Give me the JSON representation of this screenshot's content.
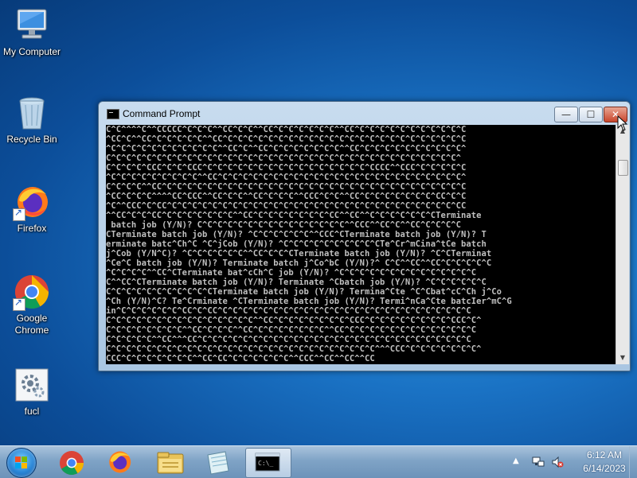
{
  "desktop": {
    "icons": [
      {
        "label": "My Computer"
      },
      {
        "label": "Recycle Bin"
      },
      {
        "label": "Firefox"
      },
      {
        "label": "Google Chrome"
      },
      {
        "label": "fucl"
      }
    ]
  },
  "window": {
    "title": "Command Prompt",
    "buttons": {
      "minimize": "—",
      "maximize": "☐",
      "close": "✕"
    },
    "console_lines": [
      "C^C^^^^C^^CCCCC^C^C^C^^CC^C^C^^CC^C^C^C^C^C^C^^CC^C^C^C^C^C^C^C^C^C^C^C",
      "^CC^C^^CC^C^C^C^C^C^^CC^C^C^C^C^C^C^C^C^C^C^C^C^C^C^C^C^C^C^C^C^C^C^C^C",
      "^C^C^C^C^C^C^C^C^C^C^C^^CC^C^^CC^C^C^C^C^C^C^C^^CC^C^C^C^C^C^C^C^C^C^C^",
      "C^C^C^C^C^C^C^C^C^C^C^C^C^C^C^C^C^C^C^C^C^C^C^C^C^C^C^C^C^C^C^C^C^C^C^",
      "C^C^C^C^CCC^C^C^CCC^C^C^C^C^C^C^C^C^C^C^C^C^C^C^C^C^CCCC^^CCC^C^C^C^C^C",
      "^C^C^C^C^C^C^C^C^C^^CC^C^C^C^C^C^C^C^C^C^C^C^C^C^C^C^C^C^C^C^C^C^C^C^C^",
      "C^C^C^C^^CC^C^C^C^C^C^C^C^C^C^C^C^C^C^C^C^C^C^C^C^C^C^C^C^C^C^C^C^C^C^C",
      "^CC^C^C^C^^^^CC^CCC^^CC^C^C^^CC^C^C^C^^CCC^C^C^^CC^C^C^C^C^C^C^C^CC^C^C",
      "^C^^CCC^C^CC^C^C^C^C^C^C^C^C^C^C^C^C^C^C^C^C^C^C^C^C^C^C^C^C^C^C^C^C^CC",
      "^^CC^C^C^CC^C^C^C^C^C^C^C^^CC^C^C^C^C^C^C^C^CC^^CC^^C^C^C^C^C^C^CTerminate",
      " batch job (Y/N)? C^C^C^C^C^C^C^C^C^C^C^C^C^C^C^^CCC^^CC^C^^CC^C^C^C^C",
      "CTerminate batch job (Y/N)? ^C^C^C^C^C^C^^CCC^CTerminate batch job (Y/N)? T",
      "erminate batc^Ch^C ^C^jCob (Y/N)? ^C^C^C^C^C^C^C^C^C^CTe^Cr^mCina^tCe batch",
      "j^Cob (Y/N^C)? ^C^C^C^C^C^C^^CC^C^C^CTerminate batch job (Y/N)? ^C^CTerminat",
      "^Ce^C batch job (Y/N)? Terminate batch j^Co^bC (Y/N)?^ C^C^^CC^^CC^C^C^C^C^C",
      "^C^C^C^C^^CC^CTerminate bat^cCh^C job (Y/N)? ^C^C^C^C^C^C^C^C^C^C^C^C^C^C",
      "C^^CC^CTerminate batch job (Y/N)? Terminate ^Cbatch job (Y/N)? ^C^C^C^C^C^C",
      "C^C^C^C^C^C^C^C^C^C^CTerminate batch job (Y/N)? Termina^Cte ^C^Cbat^cC^Ch j^Co",
      "^Ch (Y/N)^C? Te^Crminate ^CTerminate batch job (Y/N)? Termi^nCa^Cte batcIer^mC^G",
      "in^C^C^C^C^C^C^CC^C^CC^C^C^C^C^C^C^C^C^C^C^C^C^C^C^C^C^C^C^C^C^C^C^C^C^C",
      "C^C^C^C^C^C^C^C^C^C^C^C^C^C^C^^CC^C^C^C^C^C^C^C^CCC^C^C^C^C^C^C^C^C^CCC^C^",
      "C^C^C^C^C^C^C^C^^CC^C^C^C^^CC^C^C^C^C^C^C^C^^CC^C^C^C^C^C^C^C^C^C^C^C^C^C",
      "C^C^C^C^C^^CC^^^CC^C^C^C^C^C^C^C^C^C^C^C^C^C^C^C^C^C^C^C^C^C^C^C^C^C^C^C",
      "C^C^C^C^C^C^C^C^C^C^C^C^C^C^C^C^C^C^C^C^C^C^C^C^C^C^C^^^CCC^C^C^C^C^C^C^C^",
      "CCC^C^C^C^C^C^C^C^^CC^CC^C^C^C^C^C^C^^CCC^^CC^^CC^^CC"
    ]
  },
  "taskbar": {
    "pinned": [
      {
        "name": "chrome"
      },
      {
        "name": "firefox"
      },
      {
        "name": "explorer"
      },
      {
        "name": "notepad"
      },
      {
        "name": "cmd"
      }
    ],
    "tray_arrow": "▲",
    "clock_time": "6:12 AM",
    "clock_date": "6/14/2023"
  },
  "colors": {
    "desktop_bg": "#1a72c4",
    "console_bg": "#000000",
    "console_fg": "#c0c0c0",
    "close_button": "#c9462c"
  }
}
